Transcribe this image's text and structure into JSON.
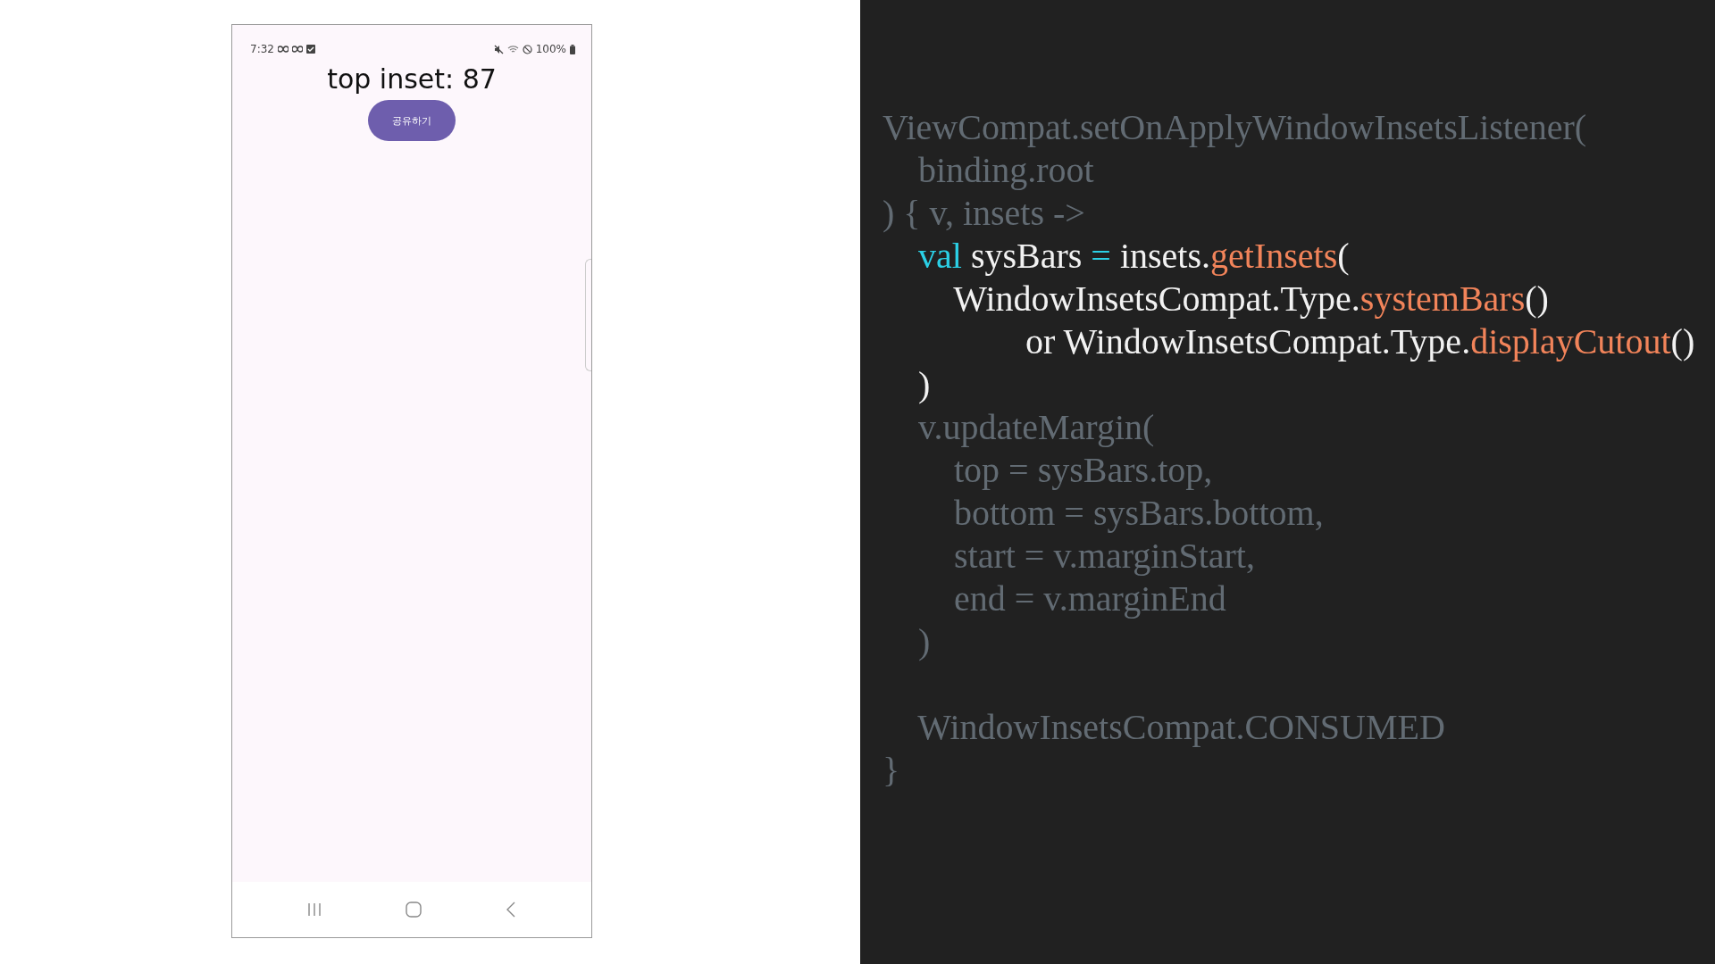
{
  "phone": {
    "status_bar": {
      "time": "7:32",
      "battery": "100%"
    },
    "title": "top inset: 87",
    "button": "공유하기"
  },
  "code": {
    "lines": [
      {
        "kind": "code",
        "segments": [
          {
            "kind": "dim",
            "text": "ViewCompat.setOnApplyWindowInsetsListener("
          }
        ]
      },
      {
        "kind": "code",
        "segments": [
          {
            "kind": "dim",
            "text": "    binding.root"
          }
        ]
      },
      {
        "kind": "code",
        "segments": [
          {
            "kind": "dim",
            "text": ") { v, insets ->"
          }
        ]
      },
      {
        "kind": "code",
        "segments": [
          {
            "kind": "keyword",
            "text": "    val"
          },
          {
            "kind": "plain",
            "text": " sysBars "
          },
          {
            "kind": "keyword",
            "text": "="
          },
          {
            "kind": "plain",
            "text": " insets."
          },
          {
            "kind": "function",
            "text": "getInsets"
          },
          {
            "kind": "plain",
            "text": "("
          }
        ]
      },
      {
        "kind": "code",
        "segments": [
          {
            "kind": "plain",
            "text": "        WindowInsetsCompat.Type."
          },
          {
            "kind": "function",
            "text": "systemBars"
          },
          {
            "kind": "plain",
            "text": "()"
          }
        ]
      },
      {
        "kind": "code",
        "segments": [
          {
            "kind": "plain",
            "text": "                or WindowInsetsCompat.Type."
          },
          {
            "kind": "function",
            "text": "displayCutout"
          },
          {
            "kind": "plain",
            "text": "()"
          }
        ]
      },
      {
        "kind": "code",
        "segments": [
          {
            "kind": "plain",
            "text": "    )"
          }
        ]
      },
      {
        "kind": "code",
        "segments": [
          {
            "kind": "dim",
            "text": "    v.updateMargin("
          }
        ]
      },
      {
        "kind": "code",
        "segments": [
          {
            "kind": "dim",
            "text": "        top = sysBars.top,"
          }
        ]
      },
      {
        "kind": "code",
        "segments": [
          {
            "kind": "dim",
            "text": "        bottom = sysBars.bottom,"
          }
        ]
      },
      {
        "kind": "code",
        "segments": [
          {
            "kind": "dim",
            "text": "        start = v.marginStart,"
          }
        ]
      },
      {
        "kind": "code",
        "segments": [
          {
            "kind": "dim",
            "text": "        end = v.marginEnd"
          }
        ]
      },
      {
        "kind": "code",
        "segments": [
          {
            "kind": "dim",
            "text": "    )"
          }
        ]
      },
      {
        "kind": "blank"
      },
      {
        "kind": "code",
        "segments": [
          {
            "kind": "dim",
            "text": "    WindowInsetsCompat.CONSUMED"
          }
        ]
      },
      {
        "kind": "code",
        "segments": [
          {
            "kind": "dim",
            "text": "}"
          }
        ]
      }
    ]
  }
}
